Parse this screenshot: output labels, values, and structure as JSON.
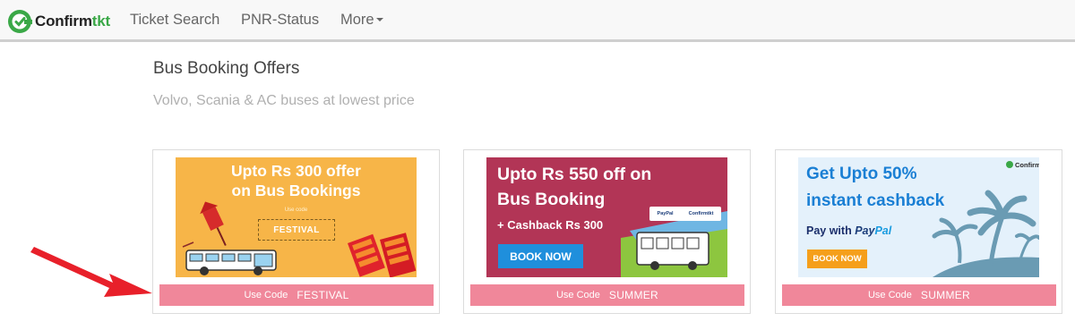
{
  "navbar": {
    "brand_confirm": "Confirm",
    "brand_tkt": "tkt",
    "items": [
      {
        "label": "Ticket Search"
      },
      {
        "label": "PNR-Status"
      },
      {
        "label": "More"
      }
    ]
  },
  "page": {
    "title": "Bus Booking Offers",
    "subtitle": "Volvo, Scania & AC buses at lowest price"
  },
  "offers": [
    {
      "banner": {
        "line1": "Upto Rs 300 offer",
        "line2": "on Bus Bookings",
        "small": "Use code",
        "code": "FESTIVAL"
      },
      "code_label": "Use Code",
      "code": "FESTIVAL"
    },
    {
      "banner": {
        "line1": "Upto Rs 550 off on",
        "line2": "Bus Booking",
        "line3": "+ Cashback Rs 300",
        "button": "BOOK NOW",
        "paypal": "PayPal",
        "partner": "Confirmtkt"
      },
      "code_label": "Use Code",
      "code": "SUMMER"
    },
    {
      "banner": {
        "line1": "Get Upto 50%",
        "line2": "instant cashback",
        "pay_with": "Pay with",
        "pay": "Pay",
        "pal": "Pal",
        "button": "BOOK NOW",
        "logo": "Confirmtkt"
      },
      "code_label": "Use Code",
      "code": "SUMMER"
    }
  ],
  "colors": {
    "brand_green": "#3aa847",
    "code_bar": "#f0879a",
    "arrow": "#e8202a"
  }
}
